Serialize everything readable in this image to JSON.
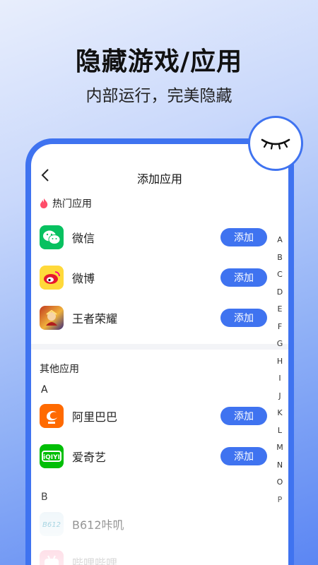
{
  "hero": {
    "title": "隐藏游戏/应用",
    "subtitle": "内部运行，完美隐藏"
  },
  "screen": {
    "back_icon": "back-chevron-icon",
    "title": "添加应用",
    "hot_section": {
      "icon": "flame-icon",
      "label": "热门应用",
      "apps": [
        {
          "name": "微信",
          "icon": "wechat-icon",
          "button": "添加"
        },
        {
          "name": "微博",
          "icon": "weibo-icon",
          "button": "添加"
        },
        {
          "name": "王者荣耀",
          "icon": "honor-of-kings-icon",
          "button": "添加"
        }
      ]
    },
    "other_section": {
      "label": "其他应用",
      "groups": [
        {
          "letter": "A",
          "apps": [
            {
              "name": "阿里巴巴",
              "icon": "alibaba-icon",
              "button": "添加"
            },
            {
              "name": "爱奇艺",
              "icon": "iqiyi-icon",
              "button": "添加"
            }
          ]
        },
        {
          "letter": "B",
          "apps": [
            {
              "name": "B612咔叽",
              "icon": "b612-icon"
            },
            {
              "name": "哔哩哔哩",
              "icon": "bilibili-icon"
            }
          ]
        }
      ]
    },
    "alpha_index": [
      "A",
      "B",
      "C",
      "D",
      "E",
      "F",
      "G",
      "H",
      "I",
      "J",
      "K",
      "L",
      "M",
      "N",
      "O",
      "P"
    ]
  },
  "colors": {
    "accent": "#3f73f0",
    "wechat": "#07c160",
    "iqiyi": "#00be06",
    "alibaba": "#ff6a00"
  },
  "badge_icon": "closed-eye-icon"
}
